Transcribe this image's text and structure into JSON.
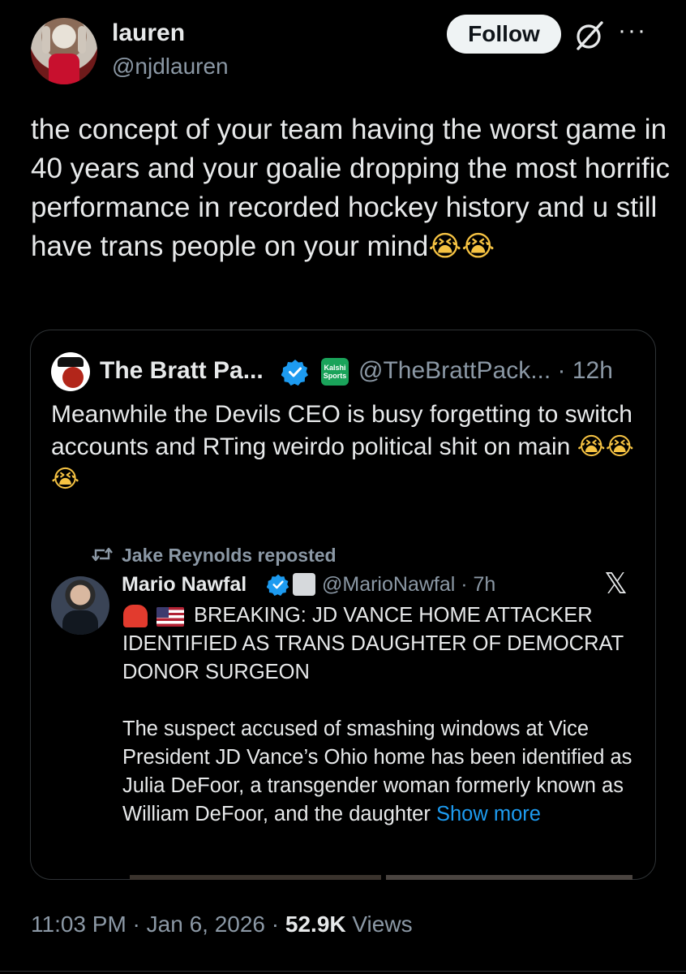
{
  "author": {
    "name": "lauren",
    "handle": "@njdlauren",
    "follow_label": "Follow"
  },
  "tweet": {
    "text": "the concept of your team having the worst game in 40 years and your goalie dropping the most horrific performance in recorded hockey history and u still have trans people on your mind",
    "emojis": "😭😭",
    "timestamp": "11:03 PM · Jan 6, 2026 · ",
    "views_count": "52.9K",
    "views_label": " Views"
  },
  "quote": {
    "name": "The Bratt Pa...",
    "handle": "@TheBrattPack... · 12h",
    "badge_text": "Kalshi Sports",
    "text": "Meanwhile the Devils CEO is busy forgetting to switch accounts and RTing weirdo political shit on main ",
    "emojis": "😭😭😭"
  },
  "nested": {
    "repost_label": "Jake Reynolds reposted",
    "name": "Mario Nawfal",
    "handle": "@MarioNawfal · 7h",
    "headline": "BREAKING: JD VANCE HOME ATTACKER IDENTIFIED AS TRANS DAUGHTER OF DEMOCRAT DONOR SURGEON",
    "body": "The suspect accused of smashing windows at Vice President JD Vance’s Ohio home has been identified as Julia DeFoor, a transgender woman formerly known as William DeFoor, and the daughter ",
    "show_more": "Show more",
    "x_logo": "𝕏"
  },
  "icons": {
    "more": "···"
  },
  "colors": {
    "background": "#000000",
    "text": "#e7e9ea",
    "muted": "#8b98a5",
    "link": "#1d9bf0",
    "verified": "#1d9bf0",
    "border": "#2f3336"
  }
}
